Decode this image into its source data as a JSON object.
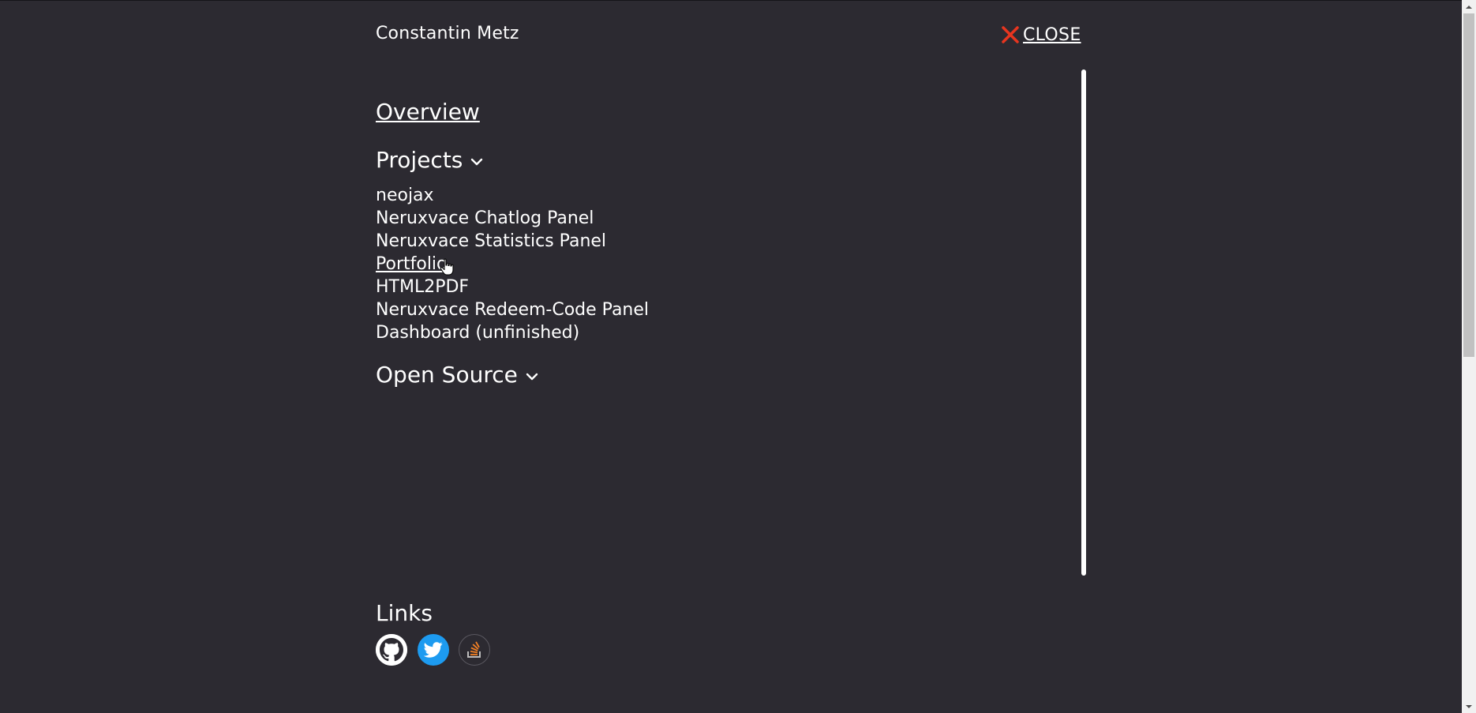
{
  "header": {
    "name": "Constantin Metz",
    "close_label": "CLOSE"
  },
  "nav": {
    "overview": "Overview",
    "projects": {
      "title": "Projects",
      "items": [
        {
          "label": "neojax"
        },
        {
          "label": "Neruxvace Chatlog Panel"
        },
        {
          "label": "Neruxvace Statistics Panel"
        },
        {
          "label": "Portfolio"
        },
        {
          "label": "HTML2PDF"
        },
        {
          "label": "Neruxvace Redeem-Code Panel"
        },
        {
          "label": "Dashboard (unfinished)"
        }
      ]
    },
    "open_source": {
      "title": "Open Source"
    }
  },
  "links": {
    "title": "Links",
    "icons": [
      "github-icon",
      "twitter-icon",
      "stackoverflow-icon"
    ]
  },
  "colors": {
    "background": "#2c2a31",
    "text": "#ffffff",
    "close_icon": "#e8351f",
    "twitter": "#1d9bf0",
    "stackoverflow": "#f48024"
  }
}
